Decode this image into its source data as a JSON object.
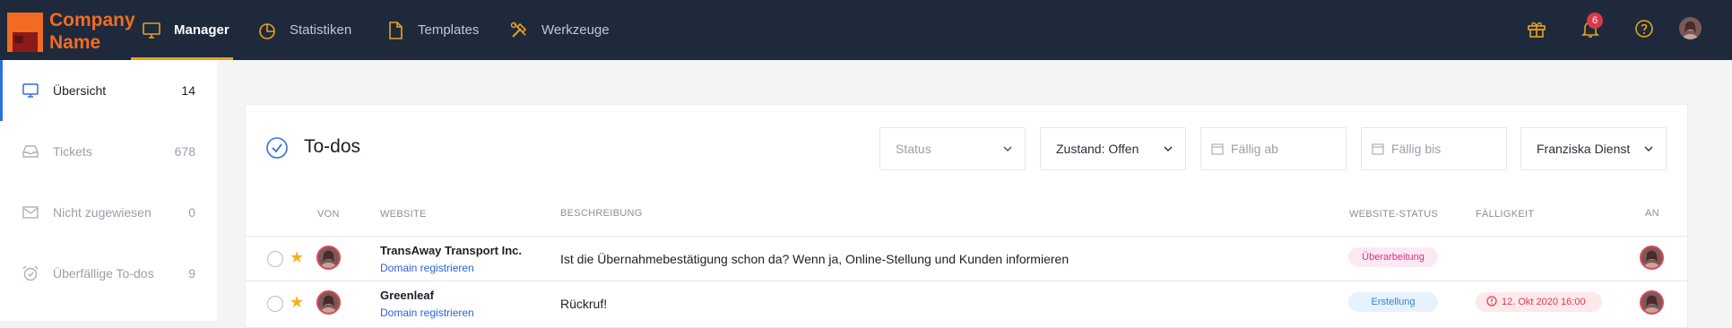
{
  "brand": {
    "name_line1": "Company",
    "name_line2": "Name",
    "logo_color": "#f26b21"
  },
  "nav": {
    "items": [
      {
        "label": "Manager",
        "icon": "monitor-icon",
        "active": true
      },
      {
        "label": "Statistiken",
        "icon": "pie-chart-icon",
        "active": false
      },
      {
        "label": "Templates",
        "icon": "document-icon",
        "active": false
      },
      {
        "label": "Werkzeuge",
        "icon": "tools-icon",
        "active": false
      }
    ],
    "right_icons": [
      "gift-icon",
      "bell-icon",
      "help-icon",
      "user-avatar"
    ],
    "notification_count": "6"
  },
  "sidebar": {
    "items": [
      {
        "label": "Übersicht",
        "count": "14",
        "icon": "monitor-icon",
        "active": true
      },
      {
        "label": "Tickets",
        "count": "678",
        "icon": "inbox-icon",
        "active": false
      },
      {
        "label": "Nicht zugewiesen",
        "count": "0",
        "icon": "mail-icon",
        "active": false
      },
      {
        "label": "Überfällige To-dos",
        "count": "9",
        "icon": "alarm-clock-icon",
        "active": false
      }
    ]
  },
  "todos": {
    "title": "To-dos",
    "filters": {
      "status_placeholder": "Status",
      "state_value": "Zustand: Offen",
      "due_from_placeholder": "Fällig ab",
      "due_to_placeholder": "Fällig bis",
      "assignee_value": "Franziska Dienst"
    },
    "columns": {
      "von": "VON",
      "website": "WEBSITE",
      "beschreibung": "BESCHREIBUNG",
      "website_status": "WEBSITE-STATUS",
      "faelligkeit": "FÄLLIGKEIT",
      "an": "AN"
    },
    "rows": [
      {
        "website": "TransAway Transport Inc.",
        "sub_link": "Domain registrieren",
        "description": "Ist die Übernahmebestätigung schon da? Wenn ja, Online-Stellung und Kunden informieren",
        "status": "Überarbeitung",
        "due": ""
      },
      {
        "website": "Greenleaf",
        "sub_link": "Domain registrieren",
        "description": "Rückruf!",
        "status": "Erstellung",
        "due": "12. Okt 2020 16:00"
      }
    ]
  },
  "colors": {
    "topbar": "#1e2a3c",
    "accent_orange": "#e8a020",
    "active_blue": "#2f6fe0",
    "status_review_bg": "#fde9f3",
    "status_review_fg": "#d63384",
    "status_create_bg": "#e6f2fd",
    "status_create_fg": "#2f86d8",
    "due_overdue_bg": "#fde8ec",
    "due_overdue_fg": "#e03a50"
  }
}
